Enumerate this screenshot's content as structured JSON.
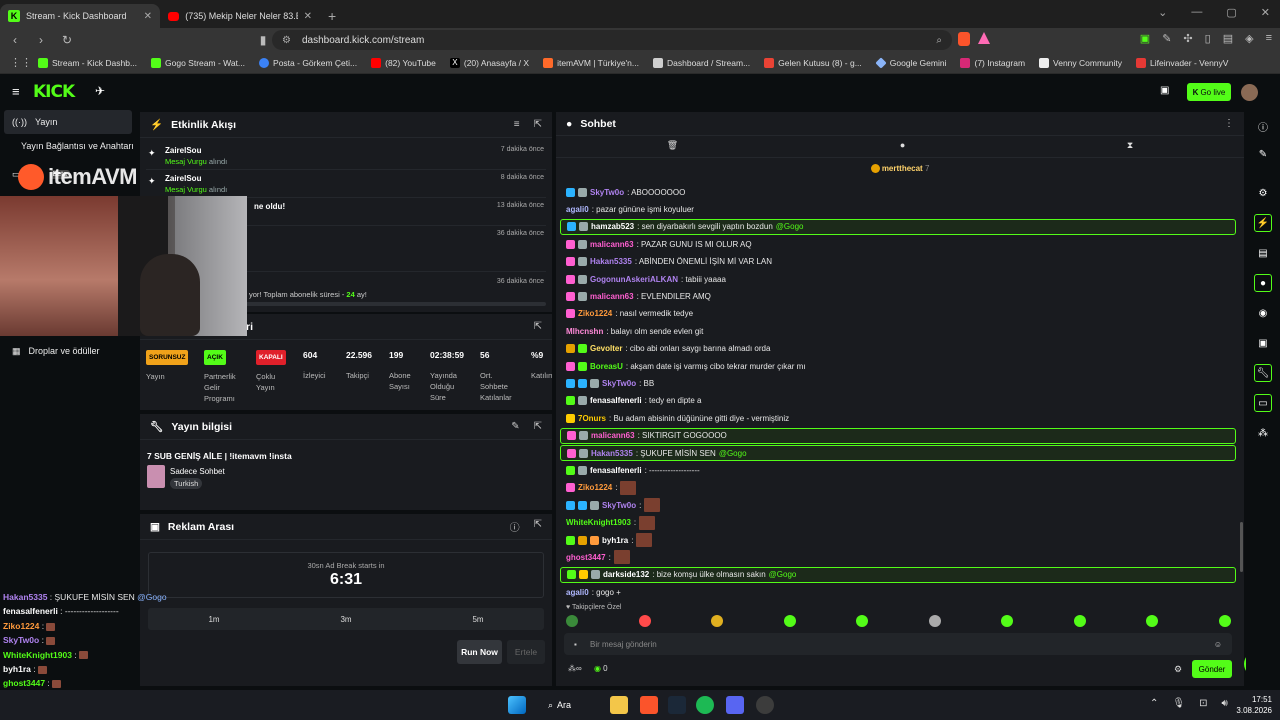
{
  "tabs": [
    {
      "title": "Stream - Kick Dashboard",
      "active": true
    },
    {
      "title": "(735) Mekip Neler Neler 83.Bölüm Ir...",
      "active": false
    }
  ],
  "address": {
    "url": "dashboard.kick.com/stream"
  },
  "bookmarks": [
    "Stream - Kick Dashb...",
    "Gogo Stream - Wat...",
    "Posta - Görkem Çeti...",
    "(82) YouTube",
    "(20) Anasayfa / X",
    "itemAVM | Türkiye'n...",
    "Dashboard / Stream...",
    "Gelen Kutusu (8) - g...",
    "Google Gemini",
    "(7) Instagram",
    "Venny Community",
    "Lifeinvader - VennyV"
  ],
  "kick": {
    "go_live": "Go live"
  },
  "sidebar": {
    "items": [
      "Yayın",
      "Yayın Bağlantısı ve Anahtarı",
      "Droplar ve ödüller"
    ],
    "beta_item": "dar",
    "beta_badge": "Beta"
  },
  "webcam_logo": "itemAVM",
  "activity": {
    "title": "Etkinlik Akışı",
    "items": [
      {
        "user": "ZairelSou",
        "highlight": "Mesaj Vurgu",
        "suffix": " alındı",
        "time": "7 dakika önce"
      },
      {
        "user": "ZairelSou",
        "highlight": "Mesaj Vurgu",
        "suffix": " alındı",
        "time": "8 dakika önce"
      },
      {
        "user": "",
        "highlight": "",
        "suffix": "ne oldu!",
        "time": "13 dakika önce"
      },
      {
        "user": "",
        "highlight": "",
        "suffix": "",
        "time": "36 dakika önce"
      },
      {
        "user": "",
        "highlight": "",
        "suffix": "yor! Toplam abonelik süresi - ",
        "extra": "24",
        "extra2": " ay!",
        "time": "36 dakika önce"
      }
    ]
  },
  "stats": {
    "title_fragment": "ri",
    "items": [
      {
        "value": "SORUNSUZ",
        "label": "Yayın",
        "badge": "orange"
      },
      {
        "value": "AÇIK",
        "label": "Partnerlik Gelir Programı",
        "badge": "green"
      },
      {
        "value": "KAPALI",
        "label": "Çoklu Yayın",
        "badge": "red"
      },
      {
        "value": "604",
        "label": "İzleyici"
      },
      {
        "value": "22.596",
        "label": "Takipçi"
      },
      {
        "value": "199",
        "label": "Abone Sayısı"
      },
      {
        "value": "02:38:59",
        "label": "Yayında Olduğu Süre"
      },
      {
        "value": "56",
        "label": "Ort. Sohbete Katılanlar"
      },
      {
        "value": "%9",
        "label": "Katılım"
      }
    ]
  },
  "stream_info": {
    "title": "Yayın bilgisi",
    "stream_title": "7 SUB GENİŞ AİLE | !itemavm !insta",
    "category": "Sadece Sohbet",
    "tag": "Turkish"
  },
  "ads": {
    "title": "Reklam Arası",
    "caption": "30sn Ad Break starts in",
    "countdown": "6:31",
    "durations": [
      "1m",
      "3m",
      "5m"
    ],
    "run_now": "Run Now",
    "snooze": "Ertele"
  },
  "chat": {
    "title": "Sohbet",
    "pinned_user": "mertthecat",
    "pinned_count": "7",
    "messages": [
      {
        "user": "SkyTw0o",
        "color": "#b083f0",
        "text": ": ABOOOOOOO",
        "icons": [
          "#2bb3ff",
          "#9aa"
        ],
        "mention": false
      },
      {
        "user": "agali0",
        "color": "#b0b8ff",
        "text": ": pazar gününe işmi koyuluer",
        "icons": [],
        "mention": false
      },
      {
        "user": "hamzab523",
        "color": "#ffffff",
        "text": ": sen diyarbakırlı sevgili yaptın bozdun ",
        "at": "@Gogo",
        "icons": [
          "#2bb3ff",
          "#9aa"
        ],
        "mention": true
      },
      {
        "user": "malicann63",
        "color": "#ff5fd1",
        "text": ": PAZAR GUNU IS MI OLUR AQ",
        "icons": [
          "#ff5fd1",
          "#9aa"
        ],
        "mention": false
      },
      {
        "user": "Hakan5335",
        "color": "#b083f0",
        "text": ": ABİNDEN ÖNEMLİ İŞİN Mİ VAR LAN",
        "icons": [
          "#ff5fd1",
          "#9aa"
        ],
        "mention": false
      },
      {
        "user": "GogonunAskeriALKAN",
        "color": "#b083f0",
        "text": ": tabiii yaaaa",
        "icons": [
          "#ff5fd1",
          "#9aa"
        ],
        "mention": false
      },
      {
        "user": "malicann63",
        "color": "#ff5fd1",
        "text": ": EVLENDILER AMQ",
        "icons": [
          "#ff5fd1",
          "#9aa"
        ],
        "mention": false
      },
      {
        "user": "Ziko1224",
        "color": "#ff9a3c",
        "text": ": nasıl vermedik tedye",
        "icons": [
          "#ff5fd1"
        ],
        "mention": false
      },
      {
        "user": "Mlhcnshn",
        "color": "#ff8ad8",
        "text": ": balayı olm sende evlen git",
        "icons": [],
        "mention": false
      },
      {
        "user": "Gevolter",
        "color": "#ffe066",
        "text": ": cibo abi onları saygı barına almadı orda",
        "icons": [
          "#e6a100",
          "#53fc18"
        ],
        "mention": false
      },
      {
        "user": "BoreasU",
        "color": "#53fc18",
        "text": ": akşam date işi varmış cibo tekrar murder çıkar mı",
        "icons": [
          "#ff5fd1",
          "#53fc18"
        ],
        "mention": false
      },
      {
        "user": "SkyTw0o",
        "color": "#b083f0",
        "text": ": BB",
        "icons": [
          "#2bb3ff",
          "#2bb3ff",
          "#9aa"
        ],
        "mention": false
      },
      {
        "user": "fenasalfenerli",
        "color": "#ffffff",
        "text": ": tedy en dipte a",
        "icons": [
          "#53fc18",
          "#9aa"
        ],
        "mention": false
      },
      {
        "user": "7Onurs",
        "color": "#ffcc00",
        "text": ": Bu adam abisinin düğününe gitti diye - vermiştiniz",
        "icons": [
          "#ffcc00"
        ],
        "mention": false
      },
      {
        "user": "malicann63",
        "color": "#ff5fd1",
        "text": ": SIKTIRGIT GOGOOOO",
        "icons": [
          "#ff5fd1",
          "#9aa"
        ],
        "mention": true
      },
      {
        "user": "Hakan5335",
        "color": "#b083f0",
        "text": ": ŞUKUFE MİSİN SEN ",
        "at": "@Gogo",
        "icons": [
          "#ff5fd1",
          "#9aa"
        ],
        "mention": true
      },
      {
        "user": "fenasalfenerli",
        "color": "#ffffff",
        "text": ": -------------------",
        "icons": [
          "#53fc18",
          "#9aa"
        ],
        "mention": false
      },
      {
        "user": "Ziko1224",
        "color": "#ff9a3c",
        "text": ":",
        "emote": true,
        "icons": [
          "#ff5fd1"
        ],
        "mention": false
      },
      {
        "user": "SkyTw0o",
        "color": "#b083f0",
        "text": ":",
        "emote": true,
        "icons": [
          "#2bb3ff",
          "#2bb3ff",
          "#9aa"
        ],
        "mention": false
      },
      {
        "user": "WhiteKnight1903",
        "color": "#53fc18",
        "text": ":",
        "emote": true,
        "icons": [],
        "mention": false
      },
      {
        "user": "byh1ra",
        "color": "#ffffff",
        "text": ":",
        "emote": true,
        "icons": [
          "#53fc18",
          "#e6a100",
          "#ff9a3c"
        ],
        "mention": false
      },
      {
        "user": "ghost3447",
        "color": "#ff5fd1",
        "text": ":",
        "emote": true,
        "icons": [],
        "mention": false
      },
      {
        "user": "darkside132",
        "color": "#ffffff",
        "text": ": bize komşu ülke olmasın sakın ",
        "at": "@Gogo",
        "icons": [
          "#53fc18",
          "#ffcc00",
          "#9aa"
        ],
        "mention": true
      },
      {
        "user": "agali0",
        "color": "#b0b8ff",
        "text": ": gogo +",
        "icons": [],
        "mention": false
      }
    ],
    "follower_label": "Takipçilere Özel",
    "input_placeholder": "Bir mesaj gönderin",
    "points": "0",
    "send": "Gönder"
  },
  "left_chat": [
    {
      "user": "Hakan5335",
      "color": "#b083f0",
      "text": " : ŞUKUFE MİSİN SEN ",
      "at": "@Gogo"
    },
    {
      "user": "fenasalfenerli",
      "color": "#ffffff",
      "text": " : -------------------"
    },
    {
      "user": "Ziko1224",
      "color": "#ff9a3c",
      "text": " : ",
      "emote": true
    },
    {
      "user": "SkyTw0o",
      "color": "#b083f0",
      "text": " : ",
      "emote": true
    },
    {
      "user": "WhiteKnight1903",
      "color": "#53fc18",
      "text": " : ",
      "emote": true
    },
    {
      "user": "byh1ra",
      "color": "#ffffff",
      "text": " : ",
      "emote": true
    },
    {
      "user": "ghost3447",
      "color": "#53fc18",
      "text": " : ",
      "emote": true
    },
    {
      "user": "darkside132",
      "color": "#ffffff",
      "text": " : bize komşu ülke olmasın sakın ",
      "at": "@Gogo"
    },
    {
      "user": "agali0",
      "color": "#ffffff",
      "text": " : gogo +"
    }
  ],
  "taskbar": {
    "search": "Ara",
    "time": "17:51",
    "date": "3.08.2026"
  },
  "colors": {
    "accent": "#53fc18",
    "panel": "#191b1f",
    "bg": "#0b0e10"
  }
}
